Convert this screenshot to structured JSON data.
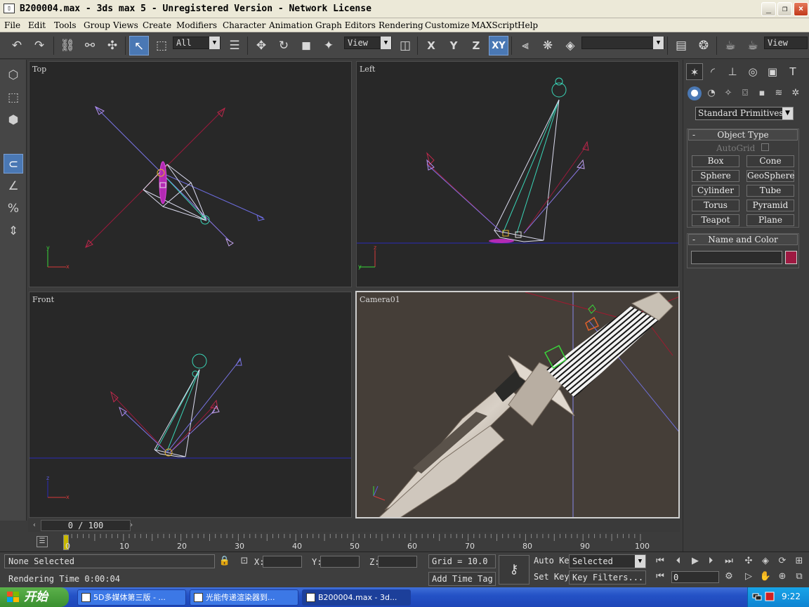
{
  "window": {
    "title": "B200004.max - 3ds max 5 - Unregistered Version - Network License",
    "controls": [
      "_",
      "❐",
      "×"
    ]
  },
  "menu": [
    "File",
    "Edit",
    "Tools",
    "Group",
    "Views",
    "Create",
    "Modifiers",
    "Character",
    "Animation",
    "Graph Editors",
    "Rendering",
    "Customize",
    "MAXScript",
    "Help"
  ],
  "toolbar": {
    "selection_filter": "All",
    "reference_coord": "View",
    "axis_x": "X",
    "axis_y": "Y",
    "axis_z": "Z",
    "axis_xy": "XY",
    "named_selection": "",
    "render_view": "View"
  },
  "viewports": {
    "top": "Top",
    "left": "Left",
    "front": "Front",
    "camera": "Camera01"
  },
  "time_slider": {
    "value": "0 / 100",
    "ticks": [
      "0",
      "10",
      "20",
      "30",
      "40",
      "50",
      "60",
      "70",
      "80",
      "90",
      "100"
    ]
  },
  "command_panel": {
    "category_dropdown": "Standard Primitives",
    "object_type_title": "Object Type",
    "autogrid_label": "AutoGrid",
    "buttons": [
      "Box",
      "Cone",
      "Sphere",
      "GeoSphere",
      "Cylinder",
      "Tube",
      "Torus",
      "Pyramid",
      "Teapot",
      "Plane"
    ],
    "name_color_title": "Name and Color",
    "object_name": "",
    "object_color": "#9e1a42"
  },
  "status": {
    "selection": "None Selected",
    "prompt": "Rendering Time  0:00:04",
    "x_label": "X:",
    "y_label": "Y:",
    "z_label": "Z:",
    "x_value": "",
    "y_value": "",
    "z_value": "",
    "grid": "Grid = 10.0",
    "add_time_tag": "Add Time Tag",
    "auto_key": "Auto Key",
    "set_key": "Set Key",
    "key_mode": "Selected",
    "key_filters": "Key Filters...",
    "current_frame": "0"
  },
  "taskbar": {
    "start": "开始",
    "tasks": [
      "5D多媒体第三版 - ...",
      "光能传递渲染器到...",
      "B200004.max - 3d..."
    ],
    "clock": "9:22"
  }
}
